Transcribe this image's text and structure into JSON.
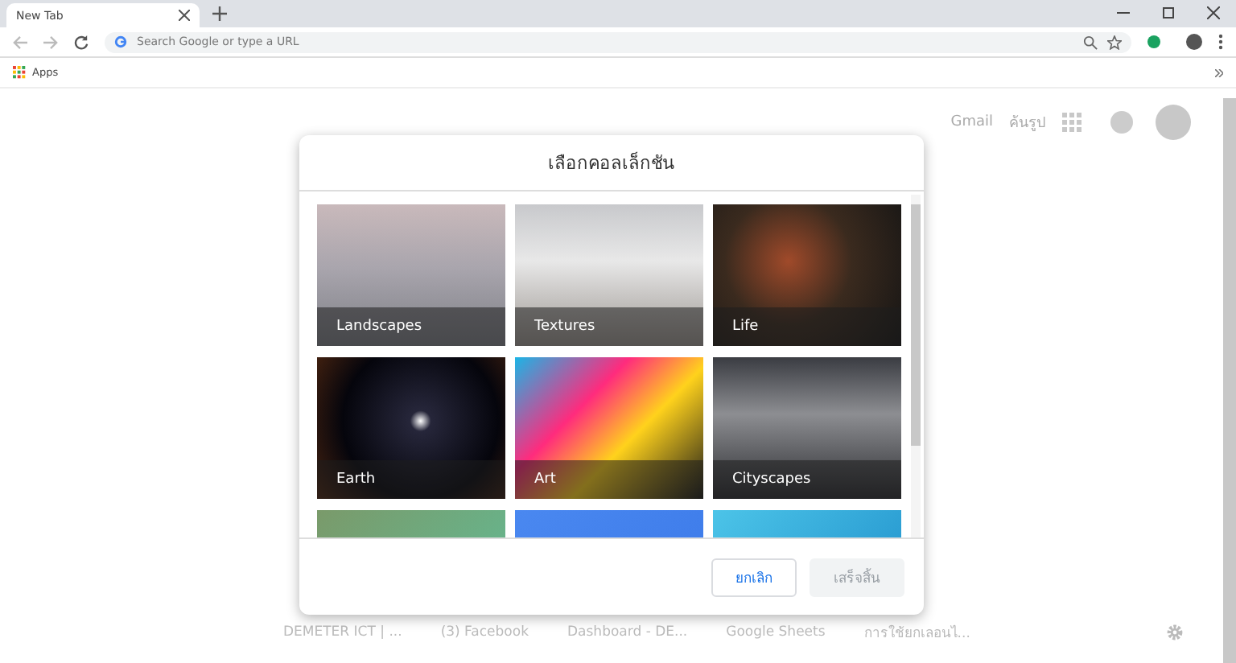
{
  "browser": {
    "tab_title": "New Tab",
    "address_placeholder": "Search Google or type a URL",
    "bookmarks": [
      "Apps"
    ]
  },
  "page": {
    "header_links": [
      "Gmail",
      "ค้นรูป"
    ],
    "shortcuts": [
      "DEMETER ICT | ...",
      "(3) Facebook",
      "Dashboard - DE...",
      "Google Sheets",
      "การใช้ยกเลอนไ..."
    ]
  },
  "dialog": {
    "title": "เลือกคอลเล็กชัน",
    "collections": [
      {
        "kind": "labeled",
        "title": "Landscapes"
      },
      {
        "kind": "labeled",
        "title": "Textures"
      },
      {
        "kind": "labeled",
        "title": "Life"
      },
      {
        "kind": "labeled",
        "title": "Earth"
      },
      {
        "kind": "labeled",
        "title": "Art"
      },
      {
        "kind": "labeled",
        "title": "Cityscapes"
      },
      {
        "kind": "cut"
      },
      {
        "kind": "cut"
      },
      {
        "kind": "cut"
      }
    ],
    "buttons": [
      {
        "label": "ยกเลิก",
        "kind": "secondary",
        "disabled": false
      },
      {
        "label": "เสร็จสิ้น",
        "kind": "primary",
        "disabled": true
      }
    ]
  }
}
